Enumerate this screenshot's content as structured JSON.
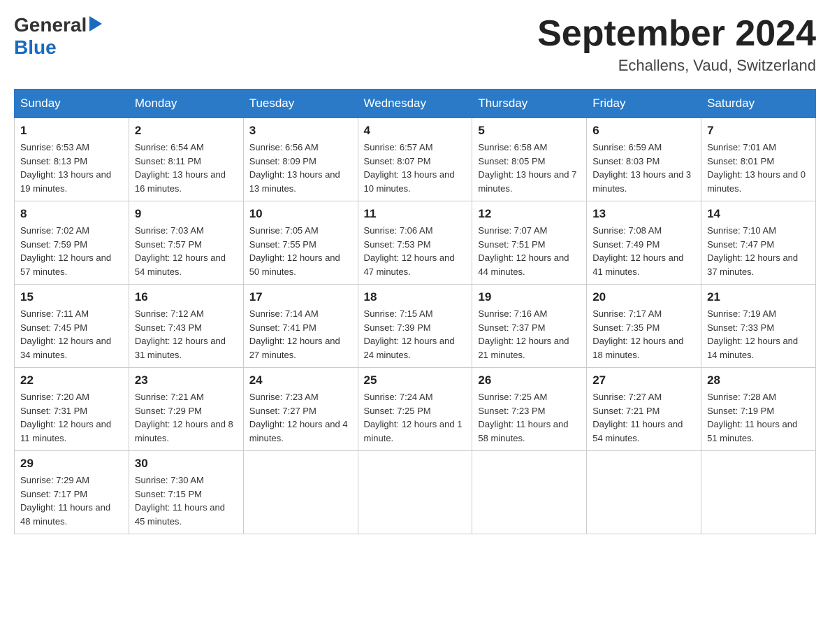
{
  "header": {
    "logo": {
      "general": "General",
      "blue": "Blue",
      "triangle": "▶"
    },
    "title": "September 2024",
    "location": "Echallens, Vaud, Switzerland"
  },
  "weekdays": [
    "Sunday",
    "Monday",
    "Tuesday",
    "Wednesday",
    "Thursday",
    "Friday",
    "Saturday"
  ],
  "weeks": [
    [
      {
        "day": "1",
        "sunrise": "6:53 AM",
        "sunset": "8:13 PM",
        "daylight": "13 hours and 19 minutes."
      },
      {
        "day": "2",
        "sunrise": "6:54 AM",
        "sunset": "8:11 PM",
        "daylight": "13 hours and 16 minutes."
      },
      {
        "day": "3",
        "sunrise": "6:56 AM",
        "sunset": "8:09 PM",
        "daylight": "13 hours and 13 minutes."
      },
      {
        "day": "4",
        "sunrise": "6:57 AM",
        "sunset": "8:07 PM",
        "daylight": "13 hours and 10 minutes."
      },
      {
        "day": "5",
        "sunrise": "6:58 AM",
        "sunset": "8:05 PM",
        "daylight": "13 hours and 7 minutes."
      },
      {
        "day": "6",
        "sunrise": "6:59 AM",
        "sunset": "8:03 PM",
        "daylight": "13 hours and 3 minutes."
      },
      {
        "day": "7",
        "sunrise": "7:01 AM",
        "sunset": "8:01 PM",
        "daylight": "13 hours and 0 minutes."
      }
    ],
    [
      {
        "day": "8",
        "sunrise": "7:02 AM",
        "sunset": "7:59 PM",
        "daylight": "12 hours and 57 minutes."
      },
      {
        "day": "9",
        "sunrise": "7:03 AM",
        "sunset": "7:57 PM",
        "daylight": "12 hours and 54 minutes."
      },
      {
        "day": "10",
        "sunrise": "7:05 AM",
        "sunset": "7:55 PM",
        "daylight": "12 hours and 50 minutes."
      },
      {
        "day": "11",
        "sunrise": "7:06 AM",
        "sunset": "7:53 PM",
        "daylight": "12 hours and 47 minutes."
      },
      {
        "day": "12",
        "sunrise": "7:07 AM",
        "sunset": "7:51 PM",
        "daylight": "12 hours and 44 minutes."
      },
      {
        "day": "13",
        "sunrise": "7:08 AM",
        "sunset": "7:49 PM",
        "daylight": "12 hours and 41 minutes."
      },
      {
        "day": "14",
        "sunrise": "7:10 AM",
        "sunset": "7:47 PM",
        "daylight": "12 hours and 37 minutes."
      }
    ],
    [
      {
        "day": "15",
        "sunrise": "7:11 AM",
        "sunset": "7:45 PM",
        "daylight": "12 hours and 34 minutes."
      },
      {
        "day": "16",
        "sunrise": "7:12 AM",
        "sunset": "7:43 PM",
        "daylight": "12 hours and 31 minutes."
      },
      {
        "day": "17",
        "sunrise": "7:14 AM",
        "sunset": "7:41 PM",
        "daylight": "12 hours and 27 minutes."
      },
      {
        "day": "18",
        "sunrise": "7:15 AM",
        "sunset": "7:39 PM",
        "daylight": "12 hours and 24 minutes."
      },
      {
        "day": "19",
        "sunrise": "7:16 AM",
        "sunset": "7:37 PM",
        "daylight": "12 hours and 21 minutes."
      },
      {
        "day": "20",
        "sunrise": "7:17 AM",
        "sunset": "7:35 PM",
        "daylight": "12 hours and 18 minutes."
      },
      {
        "day": "21",
        "sunrise": "7:19 AM",
        "sunset": "7:33 PM",
        "daylight": "12 hours and 14 minutes."
      }
    ],
    [
      {
        "day": "22",
        "sunrise": "7:20 AM",
        "sunset": "7:31 PM",
        "daylight": "12 hours and 11 minutes."
      },
      {
        "day": "23",
        "sunrise": "7:21 AM",
        "sunset": "7:29 PM",
        "daylight": "12 hours and 8 minutes."
      },
      {
        "day": "24",
        "sunrise": "7:23 AM",
        "sunset": "7:27 PM",
        "daylight": "12 hours and 4 minutes."
      },
      {
        "day": "25",
        "sunrise": "7:24 AM",
        "sunset": "7:25 PM",
        "daylight": "12 hours and 1 minute."
      },
      {
        "day": "26",
        "sunrise": "7:25 AM",
        "sunset": "7:23 PM",
        "daylight": "11 hours and 58 minutes."
      },
      {
        "day": "27",
        "sunrise": "7:27 AM",
        "sunset": "7:21 PM",
        "daylight": "11 hours and 54 minutes."
      },
      {
        "day": "28",
        "sunrise": "7:28 AM",
        "sunset": "7:19 PM",
        "daylight": "11 hours and 51 minutes."
      }
    ],
    [
      {
        "day": "29",
        "sunrise": "7:29 AM",
        "sunset": "7:17 PM",
        "daylight": "11 hours and 48 minutes."
      },
      {
        "day": "30",
        "sunrise": "7:30 AM",
        "sunset": "7:15 PM",
        "daylight": "11 hours and 45 minutes."
      },
      null,
      null,
      null,
      null,
      null
    ]
  ]
}
